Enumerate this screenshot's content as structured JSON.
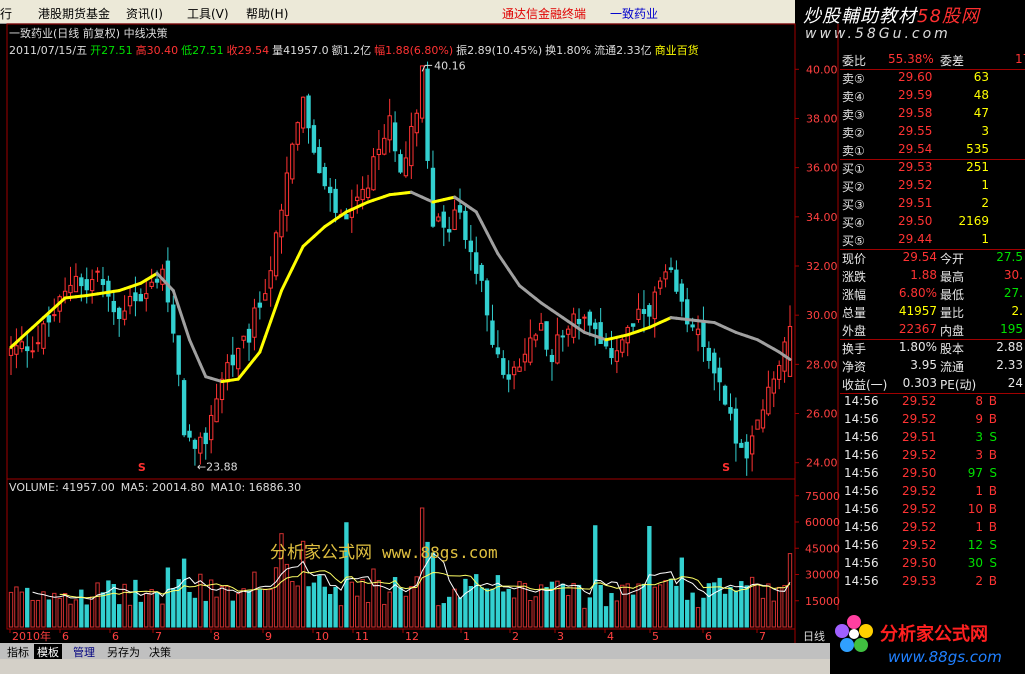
{
  "menu": {
    "items": [
      "行",
      "港股期货基金",
      "资讯(I)",
      "工具(V)",
      "帮助(H)"
    ],
    "terminal": "通达信金融终端",
    "stock": "一致药业"
  },
  "brand_top": {
    "a": "炒股輔助教材",
    "b": "58股网",
    "url": "www.58Gu.com"
  },
  "title_line": "一致药业(日线 前复权) 中线决策",
  "ohlc_line": [
    {
      "text": "2011/07/15/五",
      "color": "#dddddd"
    },
    {
      "text": "开27.51",
      "color": "#00e000"
    },
    {
      "text": "高30.40",
      "color": "#ff3333"
    },
    {
      "text": "低27.51",
      "color": "#00e000"
    },
    {
      "text": "收29.54",
      "color": "#ff3333"
    },
    {
      "text": "量41957.0",
      "color": "#dddddd"
    },
    {
      "text": "额1.2亿",
      "color": "#dddddd"
    },
    {
      "text": "幅1.88(6.80%)",
      "color": "#ff3333"
    },
    {
      "text": "振2.89(10.45%)",
      "color": "#dddddd"
    },
    {
      "text": "换1.80%",
      "color": "#dddddd"
    },
    {
      "text": "流通2.33亿",
      "color": "#dddddd"
    },
    {
      "text": "商业百货",
      "color": "#ffff00"
    }
  ],
  "volume_line": [
    "VOLUME: 41957.00",
    "MA5: 20014.80",
    "MA10: 16886.30"
  ],
  "watermark": {
    "text": "分析家公式网",
    "url": "www.88gs.com"
  },
  "chart_data": {
    "type": "candlestick",
    "price_axis": {
      "min": 23.5,
      "max": 40.5,
      "ticks": [
        "24.00",
        "26.00",
        "28.00",
        "30.00",
        "32.00",
        "34.00",
        "36.00",
        "38.00",
        "40.00"
      ]
    },
    "volume_axis": {
      "min": 0,
      "max": 80000,
      "ticks": [
        "15000",
        "30000",
        "45000",
        "60000",
        "75000"
      ]
    },
    "x_labels": [
      "2010年",
      "6",
      "6",
      "7",
      "8",
      "9",
      "10",
      "11",
      "12",
      "1",
      "2",
      "3",
      "4",
      "5",
      "6",
      "7",
      "日线"
    ],
    "annotations": {
      "high": "40.16",
      "low": "←23.88"
    },
    "close_path": [
      [
        0,
        28.5
      ],
      [
        5,
        29.0
      ],
      [
        10,
        30.8
      ],
      [
        12,
        31.8
      ],
      [
        14,
        31.0
      ],
      [
        16,
        31.8
      ],
      [
        18,
        30.5
      ],
      [
        20,
        29.8
      ],
      [
        22,
        31.0
      ],
      [
        24,
        30.5
      ],
      [
        26,
        31.2
      ],
      [
        28,
        32.0
      ],
      [
        30,
        29.0
      ],
      [
        32,
        25.5
      ],
      [
        34,
        24.2
      ],
      [
        36,
        25.0
      ],
      [
        38,
        26.8
      ],
      [
        40,
        28.0
      ],
      [
        42,
        28.3
      ],
      [
        44,
        29.2
      ],
      [
        46,
        30.5
      ],
      [
        48,
        32.0
      ],
      [
        50,
        34.0
      ],
      [
        52,
        37.2
      ],
      [
        54,
        38.5
      ],
      [
        56,
        36.5
      ],
      [
        58,
        35.0
      ],
      [
        60,
        34.2
      ],
      [
        62,
        33.6
      ],
      [
        64,
        34.5
      ],
      [
        66,
        35.2
      ],
      [
        68,
        36.8
      ],
      [
        70,
        37.8
      ],
      [
        72,
        36.2
      ],
      [
        74,
        37.3
      ],
      [
        76,
        40.0
      ],
      [
        77,
        36.5
      ],
      [
        78,
        34.0
      ],
      [
        80,
        33.2
      ],
      [
        82,
        34.3
      ],
      [
        84,
        33.4
      ],
      [
        86,
        31.8
      ],
      [
        88,
        30.2
      ],
      [
        90,
        28.2
      ],
      [
        92,
        27.2
      ],
      [
        94,
        27.8
      ],
      [
        96,
        29.0
      ],
      [
        98,
        29.6
      ],
      [
        100,
        28.5
      ],
      [
        102,
        29.2
      ],
      [
        104,
        30.0
      ],
      [
        106,
        29.8
      ],
      [
        108,
        29.1
      ],
      [
        110,
        28.3
      ],
      [
        112,
        28.8
      ],
      [
        114,
        29.3
      ],
      [
        116,
        29.8
      ],
      [
        118,
        30.4
      ],
      [
        120,
        31.2
      ],
      [
        122,
        31.5
      ],
      [
        124,
        30.2
      ],
      [
        126,
        29.5
      ],
      [
        128,
        28.6
      ],
      [
        130,
        28.0
      ],
      [
        132,
        26.5
      ],
      [
        134,
        25.0
      ],
      [
        136,
        24.0
      ],
      [
        138,
        25.5
      ],
      [
        140,
        26.8
      ],
      [
        142,
        28.2
      ],
      [
        144,
        29.54
      ]
    ],
    "ma": [
      [
        0,
        28.7
      ],
      [
        10,
        30.7
      ],
      [
        14,
        30.8
      ],
      [
        20,
        31.0
      ],
      [
        24,
        31.3
      ],
      [
        27,
        31.7
      ],
      [
        30,
        31.0
      ],
      [
        33,
        29.0
      ],
      [
        36,
        27.5
      ],
      [
        39,
        27.3
      ],
      [
        42,
        27.4
      ],
      [
        46,
        28.5
      ],
      [
        50,
        31.0
      ],
      [
        54,
        32.8
      ],
      [
        58,
        33.6
      ],
      [
        62,
        34.2
      ],
      [
        66,
        34.6
      ],
      [
        70,
        34.9
      ],
      [
        74,
        35.0
      ],
      [
        78,
        34.6
      ],
      [
        82,
        34.8
      ],
      [
        86,
        34.2
      ],
      [
        90,
        32.5
      ],
      [
        94,
        31.2
      ],
      [
        98,
        30.5
      ],
      [
        102,
        29.9
      ],
      [
        106,
        29.3
      ],
      [
        110,
        29.0
      ],
      [
        114,
        29.2
      ],
      [
        118,
        29.5
      ],
      [
        122,
        29.9
      ],
      [
        126,
        29.8
      ],
      [
        130,
        29.7
      ],
      [
        134,
        29.3
      ],
      [
        138,
        29.0
      ],
      [
        142,
        28.5
      ],
      [
        144,
        28.2
      ]
    ],
    "colors": {
      "up": "#ff3333",
      "down": "#33d0d0",
      "ma_yellow": "#ffff00",
      "ma_gray": "#a0a0a0",
      "grid": "#a00000",
      "vol_ma5": "#ffffff",
      "vol_ma10": "#ffff66"
    }
  },
  "quote": {
    "ratio": {
      "label": "委比",
      "value": "55.38%",
      "label2": "委差",
      "value2": "17"
    },
    "sells": [
      {
        "label": "卖⑤",
        "price": "29.60",
        "vol": "63"
      },
      {
        "label": "卖④",
        "price": "29.59",
        "vol": "48"
      },
      {
        "label": "卖③",
        "price": "29.58",
        "vol": "47"
      },
      {
        "label": "卖②",
        "price": "29.55",
        "vol": "3"
      },
      {
        "label": "卖①",
        "price": "29.54",
        "vol": "535"
      }
    ],
    "buys": [
      {
        "label": "买①",
        "price": "29.53",
        "vol": "251"
      },
      {
        "label": "买②",
        "price": "29.52",
        "vol": "1"
      },
      {
        "label": "买③",
        "price": "29.51",
        "vol": "2"
      },
      {
        "label": "买④",
        "price": "29.50",
        "vol": "2169"
      },
      {
        "label": "买⑤",
        "price": "29.44",
        "vol": "1"
      }
    ],
    "stats": [
      {
        "l1": "现价",
        "v1": "29.54",
        "c1": "red",
        "l2": "今开",
        "v2": "27.5",
        "c2": "green"
      },
      {
        "l1": "涨跌",
        "v1": "1.88",
        "c1": "red",
        "l2": "最高",
        "v2": "30.",
        "c2": "red"
      },
      {
        "l1": "涨幅",
        "v1": "6.80%",
        "c1": "red",
        "l2": "最低",
        "v2": "27.",
        "c2": "green"
      },
      {
        "l1": "总量",
        "v1": "41957",
        "c1": "yellow",
        "l2": "量比",
        "v2": "2.",
        "c2": "yellow"
      },
      {
        "l1": "外盘",
        "v1": "22367",
        "c1": "red",
        "l2": "内盘",
        "v2": "195",
        "c2": "green"
      }
    ],
    "fundamentals": [
      {
        "l1": "换手",
        "v1": "1.80%",
        "l2": "股本",
        "v2": "2.88"
      },
      {
        "l1": "净资",
        "v1": "3.95",
        "l2": "流通",
        "v2": "2.33"
      },
      {
        "l1": "收益(一)",
        "v1": "0.303",
        "l2": "PE(动)",
        "v2": "24"
      }
    ],
    "ticks": [
      {
        "time": "14:56",
        "price": "29.52",
        "vol": "8",
        "side": "B"
      },
      {
        "time": "14:56",
        "price": "29.52",
        "vol": "9",
        "side": "B"
      },
      {
        "time": "14:56",
        "price": "29.51",
        "vol": "3",
        "side": "S"
      },
      {
        "time": "14:56",
        "price": "29.52",
        "vol": "3",
        "side": "B"
      },
      {
        "time": "14:56",
        "price": "29.50",
        "vol": "97",
        "side": "S"
      },
      {
        "time": "14:56",
        "price": "29.52",
        "vol": "1",
        "side": "B"
      },
      {
        "time": "14:56",
        "price": "29.52",
        "vol": "10",
        "side": "B"
      },
      {
        "time": "14:56",
        "price": "29.52",
        "vol": "1",
        "side": "B"
      },
      {
        "time": "14:56",
        "price": "29.52",
        "vol": "12",
        "side": "S"
      },
      {
        "time": "14:56",
        "price": "29.50",
        "vol": "30",
        "side": "S"
      },
      {
        "time": "14:56",
        "price": "29.53",
        "vol": "2",
        "side": "B"
      }
    ]
  },
  "tabs": [
    "指标",
    "模板",
    "管理",
    "另存为",
    "决策"
  ],
  "brand_bottom": {
    "name": "分析家公式网",
    "url": "www.88gs.com"
  }
}
